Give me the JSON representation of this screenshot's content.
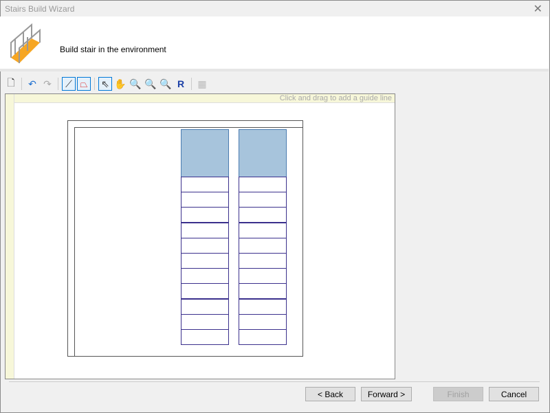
{
  "window": {
    "title": "Stairs Build Wizard",
    "close": "✕"
  },
  "header": {
    "subtitle": "Build stair in the environment"
  },
  "toolbar": [
    {
      "name": "new-icon",
      "glyph": "🗋"
    },
    {
      "name": "undo-icon",
      "glyph": "↶"
    },
    {
      "name": "redo-icon",
      "glyph": "↷"
    },
    {
      "name": "draw-line-icon",
      "glyph": "⟋",
      "selected": true
    },
    {
      "name": "draw-shape-icon",
      "glyph": "⏢",
      "selected": true
    },
    {
      "name": "pointer-icon",
      "glyph": "⇖",
      "selected": true
    },
    {
      "name": "pan-icon",
      "glyph": "✋"
    },
    {
      "name": "zoom-in-out-icon",
      "glyph": "🔍"
    },
    {
      "name": "zoom-fit-icon",
      "glyph": "🔍"
    },
    {
      "name": "zoom-reset-icon",
      "glyph": "🔍"
    },
    {
      "name": "redraw-icon",
      "glyph": "R"
    },
    {
      "name": "stairs-3d-icon",
      "glyph": "▦"
    }
  ],
  "canvas": {
    "hint": "Click and drag to add a guide line",
    "landing_color": "#a7c4dc",
    "tread_color": "#3a2f8c",
    "steps_per_flight": 11
  },
  "buttons": {
    "back": "< Back",
    "forward": "Forward >",
    "finish": "Finish",
    "cancel": "Cancel"
  }
}
